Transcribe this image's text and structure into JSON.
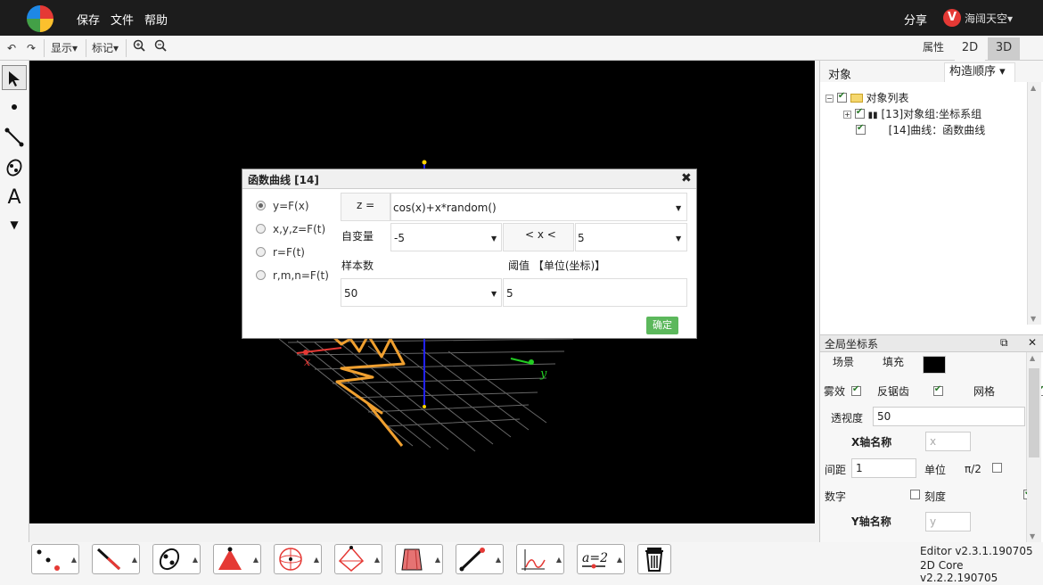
{
  "topbar": {
    "save": "保存",
    "file": "文件",
    "help": "帮助",
    "share": "分享",
    "brand_letter": "V",
    "user": "海阔天空▾"
  },
  "toolbar": {
    "display": "显示▾",
    "mark": "标记▾",
    "attr_tab": "属性",
    "tab_2d": "2D",
    "tab_3d": "3D"
  },
  "left_tools": {
    "text_tool": "A"
  },
  "objects": {
    "title": "对象",
    "order_tab": "构造顺序 ▾",
    "root": "对象列表",
    "item1": "[13]对象组:坐标系组",
    "item2": "[14]曲线：函数曲线"
  },
  "coord": {
    "title": "全局坐标系",
    "scene": "场景",
    "fill": "填充",
    "fill_color": "#000000",
    "fog": "雾效",
    "antialias": "反锯齿",
    "grid": "网格",
    "perspective_label": "透视度",
    "perspective_value": "50",
    "x_axis_title": "X轴名称",
    "x_axis_placeholder": "x",
    "spacing_label": "间距",
    "spacing_value": "1",
    "unit_label": "单位",
    "unit_pi": "π/2",
    "digits": "数字",
    "scale": "刻度",
    "y_axis_title": "Y轴名称",
    "y_axis_placeholder": "y"
  },
  "canvas": {
    "axis_x": "x",
    "axis_y": "y",
    "bg": "#000000",
    "curve_color": "#f0a030"
  },
  "dialog": {
    "title": "函数曲线 [14]",
    "close": "✖",
    "options": [
      "y=F(x)",
      "x,y,z=F(t)",
      "r=F(t)",
      "r,m,n=F(t)"
    ],
    "selected_option": "y=F(x)",
    "z_label": "z =",
    "expression": "cos(x)+x*random()",
    "var_label": "自变量",
    "from": "-5",
    "range_label": "< x <",
    "to": "5",
    "samples_label": "样本数",
    "threshold_label": "阈值 【单位(坐标)】",
    "samples": "50",
    "threshold": "5",
    "ok": "确定"
  },
  "footer": {
    "editor_version": "Editor v2.3.1.190705",
    "core_version": "2D Core v2.2.2.190705",
    "formula_glyph": "a=2"
  }
}
